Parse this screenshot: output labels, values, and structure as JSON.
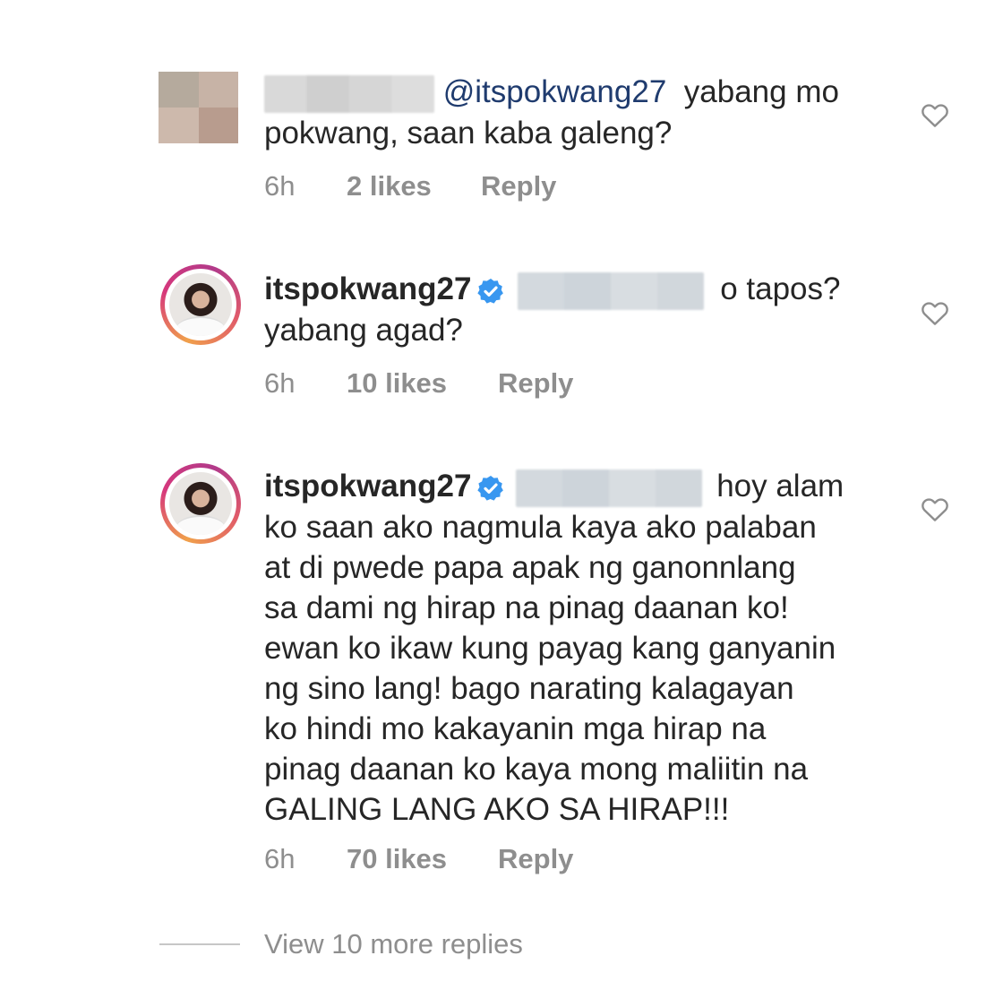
{
  "comments": [
    {
      "mention": "@itspokwang27",
      "text_line1": "yabang mo",
      "text_line2": "pokwang, saan kaba galeng?",
      "time": "6h",
      "likes": "2 likes",
      "reply": "Reply"
    },
    {
      "username": "itspokwang27",
      "text_line1": "o tapos?",
      "text_line2": "yabang agad?",
      "time": "6h",
      "likes": "10 likes",
      "reply": "Reply"
    },
    {
      "username": "itspokwang27",
      "text_line1": "hoy alam",
      "lines": [
        "ko saan ako nagmula kaya ako palaban",
        "at di pwede papa apak ng ganonnlang",
        "sa dami ng hirap na pinag daanan ko!",
        "ewan ko ikaw kung payag kang ganyanin",
        "ng sino lang! bago narating kalagayan",
        "ko hindi mo kakayanin mga hirap na",
        "pinag daanan ko kaya mong maliitin na",
        "GALING LANG AKO SA HIRAP!!!"
      ],
      "time": "6h",
      "likes": "70 likes",
      "reply": "Reply"
    }
  ],
  "view_more": "View 10 more replies",
  "colors": {
    "verified": "#3897f0",
    "meta": "#8e8e8e",
    "text": "#262626"
  },
  "icons": {
    "like": "heart-outline-icon",
    "verified": "verified-badge-icon"
  }
}
